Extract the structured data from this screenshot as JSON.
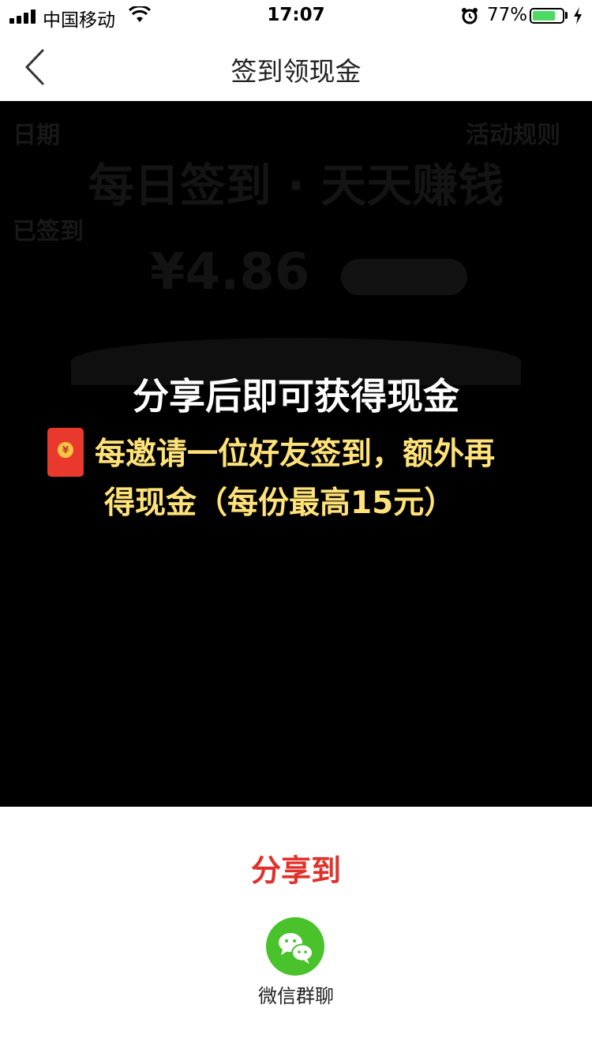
{
  "status_bar": {
    "carrier": "中国移动",
    "time": "17:07",
    "battery_percent": "77%",
    "battery_level": 0.77
  },
  "nav": {
    "title": "签到领现金",
    "back_icon": "chevron-left-icon"
  },
  "background": {
    "ghost_text_1": "日期",
    "ghost_text_2": "活动规则",
    "ghost_headline": "每日签到 · 天天赚钱",
    "ghost_text_3": "已签到",
    "ghost_amount": "¥4.86"
  },
  "overlay": {
    "headline": "分享后即可获得现金",
    "promo_line_1": "每邀请一位好友签到，额外再",
    "promo_line_2": "得现金（每份最高15元）",
    "promo_icon": "red-packet-icon"
  },
  "share": {
    "title": "分享到",
    "targets": [
      {
        "label": "微信群聊",
        "icon": "wechat-icon",
        "color": "#49c22b"
      }
    ]
  },
  "colors": {
    "overlay_bg": "#000000",
    "headline": "#ffffff",
    "promo_text": "#ffe278",
    "share_title": "#e0322b",
    "battery": "#4cd964"
  }
}
